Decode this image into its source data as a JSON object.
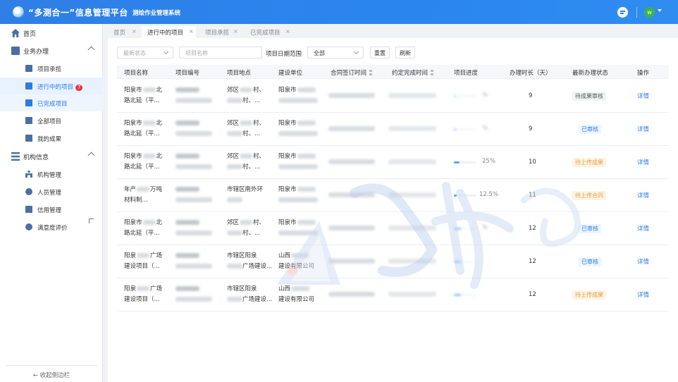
{
  "header": {
    "title": "“多测合一”信息管理平台",
    "subtitle": "测绘作业管理系统",
    "avatar_letter": "w"
  },
  "sidebar": {
    "home": "首页",
    "business": "业务办理",
    "business_items": [
      "项目承揽",
      "进行中的项目",
      "已完成项目",
      "全部项目",
      "我的成果"
    ],
    "ongoing_badge": "7",
    "org": "机构信息",
    "org_items": [
      "机构管理",
      "人员管理",
      "信用管理",
      "满意度评价"
    ],
    "collapse": "← 收起侧边栏"
  },
  "tabs": [
    {
      "label": "首页"
    },
    {
      "label": "进行中的项目"
    },
    {
      "label": "项目承揽"
    },
    {
      "label": "已完成项目"
    }
  ],
  "filters": {
    "status_placeholder": "最新状态",
    "name_placeholder": "项目名称",
    "date_label": "项目日期范围",
    "date_value": "全部",
    "reset": "重置",
    "refresh": "刷新"
  },
  "table": {
    "columns": [
      "项目名称",
      "项目编号",
      "项目地点",
      "建设单位",
      "合同签订时间",
      "约定完成时间",
      "项目进度",
      "办理时长（天）",
      "最新办理状态",
      "操作"
    ],
    "rows": [
      {
        "name1": "阳泉市",
        "name1b": "北",
        "name2": "路北延（平...",
        "loc1": "郊区",
        "loc1b": "村、",
        "loc2": "村、...",
        "unit1": "阳泉市",
        "unit2": "",
        "progress": 0.05,
        "progress_text": "%",
        "days": "9",
        "status": "待成果审核",
        "status_type": "gray",
        "action": "详情"
      },
      {
        "name1": "阳泉市",
        "name1b": "北",
        "name2": "路北延（平...",
        "loc1": "郊区",
        "loc1b": "村、",
        "loc2": "村、...",
        "unit1": "阳泉市",
        "unit2": "",
        "progress": 0.1,
        "progress_text": "%",
        "days": "9",
        "status": "已审核",
        "status_type": "blue",
        "action": "详情"
      },
      {
        "name1": "阳泉市",
        "name1b": "北",
        "name2": "路北延（平...",
        "loc1": "郊区",
        "loc1b": "村、",
        "loc2": "村、...",
        "unit1": "阳泉市",
        "unit2": "",
        "progress": 0.25,
        "progress_text": "25%",
        "days": "10",
        "status": "待上传成果",
        "status_type": "orange",
        "action": "详情"
      },
      {
        "name1": "年产",
        "name1b": "万吨",
        "name2": "材料制...",
        "loc1": "市辖区南外环",
        "loc1b": "",
        "loc2": "",
        "unit1": "阳泉市",
        "unit2": "",
        "progress": 0.125,
        "progress_text": "12.5%",
        "days": "11",
        "status": "待上传合同",
        "status_type": "orange",
        "action": "详情"
      },
      {
        "name1": "阳泉市",
        "name1b": "北",
        "name2": "路北延（平...",
        "loc1": "郊区",
        "loc1b": "村、",
        "loc2": "村、...",
        "unit1": "阳泉市",
        "unit2": "",
        "progress": 0.3,
        "progress_text": "%",
        "days": "12",
        "status": "已审核",
        "status_type": "blue",
        "action": "详情"
      },
      {
        "name1": "阳泉",
        "name1b": "广场",
        "name2": "建设项目（...",
        "loc1": "市辖区阳泉",
        "loc1b": "",
        "loc2": "广场建设...",
        "unit1": "山西",
        "unit2": "建设有限公司",
        "progress": 0.3,
        "progress_text": "",
        "days": "12",
        "status": "已审核",
        "status_type": "blue",
        "action": "详情"
      },
      {
        "name1": "阳泉",
        "name1b": "广场",
        "name2": "建设项目（...",
        "loc1": "市辖区阳泉",
        "loc1b": "",
        "loc2": "广场建设...",
        "unit1": "山西",
        "unit2": "建设有限公司",
        "progress": 0.3,
        "progress_text": "",
        "days": "12",
        "status": "待上传成果",
        "status_type": "orange",
        "action": "详情"
      }
    ]
  },
  "colors": {
    "accent": "#2d7be5",
    "header": "#2f7fe6",
    "badge": "#e8344a",
    "status_orange": "#e6a23c"
  }
}
